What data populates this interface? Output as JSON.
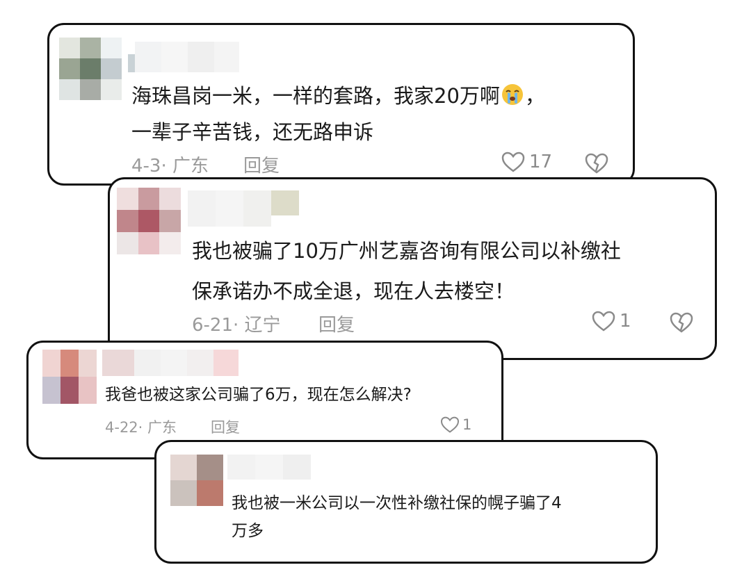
{
  "comments": [
    {
      "text_lines": [
        "海珠昌岗一米，一样的套路，我家20万啊😭，",
        "一辈子辛苦钱，还无路申诉"
      ],
      "date_region": "4-3· 广东",
      "reply": "回复",
      "likes": "17",
      "emoji": "crying-face"
    },
    {
      "text_lines": [
        "我也被骗了10万广州艺嘉咨询有限公司以补缴社",
        "保承诺办不成全退，现在人去楼空！"
      ],
      "date_region": "6-21· 辽宁",
      "reply": "回复",
      "likes": "1"
    },
    {
      "text_lines": [
        "我爸也被这家公司骗了6万，现在怎么解决?"
      ],
      "date_region": "4-22· 广东",
      "reply": "回复",
      "likes": "1"
    },
    {
      "text_lines": [
        "我也被一米公司以一次性补缴社保的幌子骗了4",
        "万多"
      ]
    }
  ],
  "colors": {
    "border": "#111111",
    "meta": "#9a9a9a",
    "text": "#1a1a1a"
  }
}
